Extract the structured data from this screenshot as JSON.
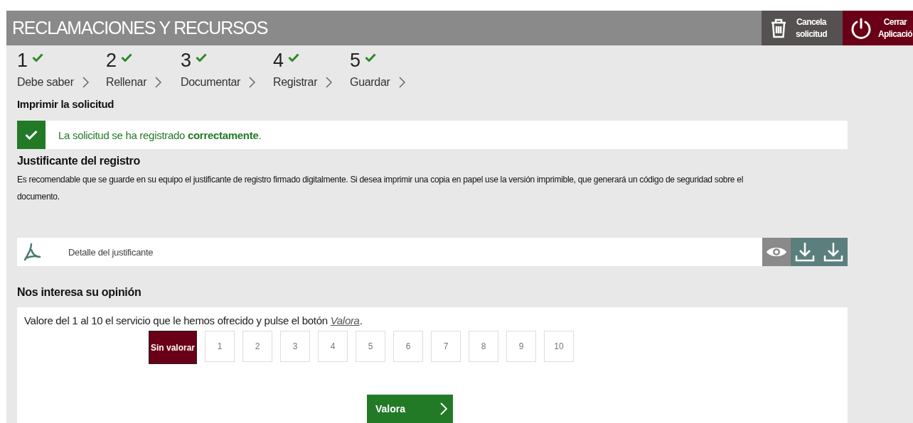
{
  "header": {
    "title": "RECLAMACIONES Y RECURSOS",
    "actions": [
      {
        "kind": "cancel",
        "lines": [
          "Cancela",
          "solicitud"
        ]
      },
      {
        "kind": "close",
        "lines": [
          "Cerrar",
          "Aplicació"
        ]
      }
    ]
  },
  "steps": [
    {
      "number": "1",
      "label": "Debe saber",
      "done": true
    },
    {
      "number": "2",
      "label": "Rellenar",
      "done": true
    },
    {
      "number": "3",
      "label": "Documentar",
      "done": true
    },
    {
      "number": "4",
      "label": "Registrar",
      "done": true
    },
    {
      "number": "5",
      "label": "Guardar",
      "done": true
    }
  ],
  "section_title": "Imprimir la solicitud",
  "success_message": "La solicitud se ha registrado **correctamente**.",
  "receipt": {
    "title": "Justificante del registro",
    "text": "Es recomendable que se guarde en su equipo el justificante de registro firmado digitalmente. Si desea imprimir una copia en papel use la versión imprimible, que generará un código de seguridad sobre el documento.",
    "document": "Detalle del justificante"
  },
  "opinion": {
    "title": "Nos interesa su opinión",
    "instruction_before": "Valore del 1 al 10 el servicio que le hemos ofrecido y pulse el botón ",
    "instruction_link": "Valora",
    "instruction_after": ".",
    "options": [
      {
        "label": "Sin valorar",
        "selected": true
      },
      {
        "label": "1",
        "selected": false
      },
      {
        "label": "2",
        "selected": false
      },
      {
        "label": "3",
        "selected": false
      },
      {
        "label": "4",
        "selected": false
      },
      {
        "label": "5",
        "selected": false
      },
      {
        "label": "6",
        "selected": false
      },
      {
        "label": "7",
        "selected": false
      },
      {
        "label": "8",
        "selected": false
      },
      {
        "label": "9",
        "selected": false
      },
      {
        "label": "10",
        "selected": false
      }
    ],
    "submit": "Valora"
  }
}
